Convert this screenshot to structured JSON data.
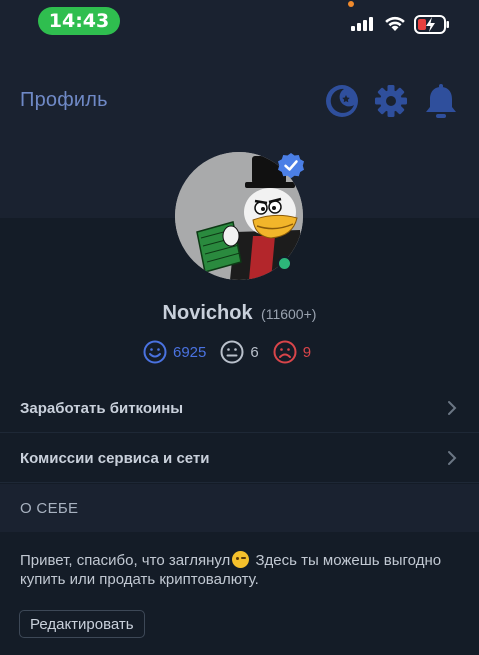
{
  "status_bar": {
    "time": "14:43"
  },
  "header": {
    "title": "Профиль"
  },
  "icons": {
    "theme": "moon-icon",
    "settings": "gear-icon",
    "notifications": "bell-icon"
  },
  "profile": {
    "username": "Novichok",
    "rating": "(11600+)",
    "verified": true,
    "online": true,
    "reviews": {
      "positive": "6925",
      "neutral": "6",
      "negative": "9"
    }
  },
  "menu": [
    {
      "label": "Заработать биткоины"
    },
    {
      "label": "Комиссии сервиса и сети"
    }
  ],
  "about": {
    "header": "О СЕБЕ",
    "text_before": "Привет, спасибо, что заглянул",
    "text_after": " Здесь ты можешь выгодно купить или продать криптовалюту.",
    "edit_label": "Редактировать"
  },
  "colors": {
    "accent": "#2f4f9c",
    "title": "#6f89c6",
    "positive": "#4a72e0",
    "neutral": "#b9c0cb",
    "negative": "#d9454a",
    "online": "#2db67a",
    "time_pill": "#2fbe4f"
  }
}
